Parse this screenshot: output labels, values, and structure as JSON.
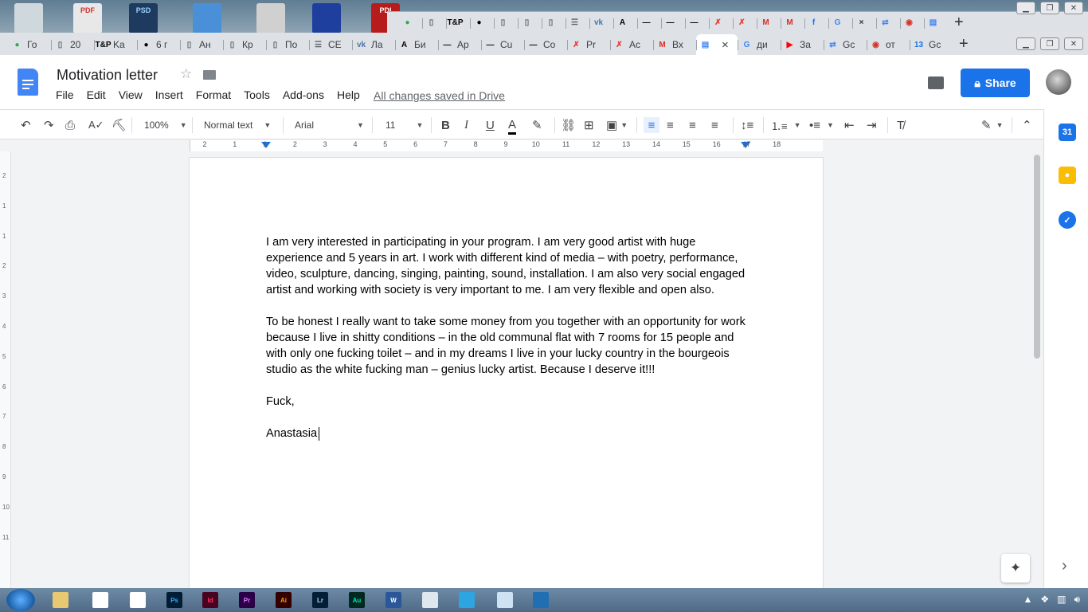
{
  "desktop": {
    "icons": [
      {
        "name": "recycle-bin-icon",
        "label": "",
        "color": "#cfd8dc",
        "text_color": "#fff"
      },
      {
        "name": "acrobat-icon",
        "label": "PDF",
        "color": "#e8e8e8",
        "text_color": "#d32f2f"
      },
      {
        "name": "photoshop-file-icon",
        "label": "PSD",
        "color": "#1e3a5f",
        "text_color": "#9ad4ff"
      },
      {
        "name": "app-icon",
        "label": "",
        "color": "#4a90d9",
        "text_color": "#fff"
      },
      {
        "name": "cd-icon",
        "label": "",
        "color": "#d0d0d0",
        "text_color": "#fff"
      },
      {
        "name": "floppy-icon",
        "label": "",
        "color": "#1f3f9f",
        "text_color": "#fff"
      },
      {
        "name": "pdf-file-icon",
        "label": "PDI",
        "color": "#b71c1c",
        "text_color": "#fff"
      }
    ]
  },
  "back_window": {
    "tabs": [
      {
        "name": "tab-back-1",
        "icon": "●",
        "icon_color": "#34a853",
        "label": ""
      },
      {
        "name": "tab-back-2",
        "icon": "▯",
        "icon_color": "#5f6368",
        "label": ""
      },
      {
        "name": "tab-back-3",
        "icon": "T&P",
        "icon_color": "#000",
        "label": ""
      },
      {
        "name": "tab-back-4",
        "icon": "●",
        "icon_color": "#000",
        "label": ""
      },
      {
        "name": "tab-back-5",
        "icon": "▯",
        "icon_color": "#5f6368",
        "label": ""
      },
      {
        "name": "tab-back-6",
        "icon": "▯",
        "icon_color": "#5f6368",
        "label": ""
      },
      {
        "name": "tab-back-7",
        "icon": "▯",
        "icon_color": "#5f6368",
        "label": ""
      },
      {
        "name": "tab-back-8",
        "icon": "☰",
        "icon_color": "#5f6368",
        "label": ""
      },
      {
        "name": "tab-back-9",
        "icon": "vk",
        "icon_color": "#4a76a8",
        "label": ""
      },
      {
        "name": "tab-back-10",
        "icon": "A",
        "icon_color": "#000",
        "label": ""
      },
      {
        "name": "tab-back-11",
        "icon": "—",
        "icon_color": "#000",
        "label": ""
      },
      {
        "name": "tab-back-12",
        "icon": "—",
        "icon_color": "#000",
        "label": ""
      },
      {
        "name": "tab-back-13",
        "icon": "—",
        "icon_color": "#000",
        "label": ""
      },
      {
        "name": "tab-back-14",
        "icon": "✗",
        "icon_color": "#e53935",
        "label": ""
      },
      {
        "name": "tab-back-15",
        "icon": "✗",
        "icon_color": "#e53935",
        "label": ""
      },
      {
        "name": "tab-back-16",
        "icon": "M",
        "icon_color": "#d93025",
        "label": ""
      },
      {
        "name": "tab-back-17",
        "icon": "M",
        "icon_color": "#d93025",
        "label": ""
      },
      {
        "name": "tab-back-18",
        "icon": "f",
        "icon_color": "#1877f2",
        "label": ""
      },
      {
        "name": "tab-back-19",
        "icon": "G",
        "icon_color": "#4285f4",
        "label": ""
      },
      {
        "name": "tab-back-20",
        "icon": "×",
        "icon_color": "#333",
        "label": ""
      },
      {
        "name": "tab-back-21",
        "icon": "⇄",
        "icon_color": "#4285f4",
        "label": ""
      },
      {
        "name": "tab-back-22",
        "icon": "◉",
        "icon_color": "#d93025",
        "label": ""
      },
      {
        "name": "tab-back-23",
        "icon": "▤",
        "icon_color": "#4285f4",
        "label": ""
      }
    ]
  },
  "browser": {
    "tabs": [
      {
        "name": "tab-1",
        "icon": "●",
        "icon_color": "#34a853",
        "label": "Го"
      },
      {
        "name": "tab-2",
        "icon": "▯",
        "icon_color": "#5f6368",
        "label": "20"
      },
      {
        "name": "tab-3",
        "icon": "T&P",
        "icon_color": "#000",
        "label": "Ka"
      },
      {
        "name": "tab-4",
        "icon": "●",
        "icon_color": "#000",
        "label": "6 г"
      },
      {
        "name": "tab-5",
        "icon": "▯",
        "icon_color": "#5f6368",
        "label": "Ан"
      },
      {
        "name": "tab-6",
        "icon": "▯",
        "icon_color": "#5f6368",
        "label": "Кр"
      },
      {
        "name": "tab-7",
        "icon": "▯",
        "icon_color": "#5f6368",
        "label": "По"
      },
      {
        "name": "tab-8",
        "icon": "☰",
        "icon_color": "#5f6368",
        "label": "CE"
      },
      {
        "name": "tab-9",
        "icon": "vk",
        "icon_color": "#4a76a8",
        "label": "Ла"
      },
      {
        "name": "tab-10",
        "icon": "A",
        "icon_color": "#000",
        "label": "Би"
      },
      {
        "name": "tab-11",
        "icon": "—",
        "icon_color": "#000",
        "label": "Ар"
      },
      {
        "name": "tab-12",
        "icon": "—",
        "icon_color": "#000",
        "label": "Cu"
      },
      {
        "name": "tab-13",
        "icon": "—",
        "icon_color": "#000",
        "label": "Co"
      },
      {
        "name": "tab-14",
        "icon": "✗",
        "icon_color": "#e53935",
        "label": "Pr"
      },
      {
        "name": "tab-15",
        "icon": "✗",
        "icon_color": "#e53935",
        "label": "Ac"
      },
      {
        "name": "tab-16",
        "icon": "M",
        "icon_color": "#d93025",
        "label": "Вх"
      },
      {
        "name": "tab-17",
        "icon": "▤",
        "icon_color": "#4285f4",
        "label": ""
      },
      {
        "name": "tab-18",
        "icon": "G",
        "icon_color": "#4285f4",
        "label": "ди"
      },
      {
        "name": "tab-19",
        "icon": "▶",
        "icon_color": "#ff0000",
        "label": "За"
      },
      {
        "name": "tab-20",
        "icon": "⇄",
        "icon_color": "#4285f4",
        "label": "Gc"
      },
      {
        "name": "tab-21",
        "icon": "◉",
        "icon_color": "#d93025",
        "label": "от"
      },
      {
        "name": "tab-22",
        "icon": "13",
        "icon_color": "#1a73e8",
        "label": "Gc"
      }
    ],
    "active_tab_index": 16,
    "close_glyph": "×",
    "new_tab_glyph": "+"
  },
  "docs": {
    "title": "Motivation letter",
    "menu": [
      "File",
      "Edit",
      "View",
      "Insert",
      "Format",
      "Tools",
      "Add-ons",
      "Help"
    ],
    "saved_status": "All changes saved in Drive",
    "share_label": "Share",
    "toolbar": {
      "zoom": "100%",
      "style": "Normal text",
      "font": "Arial",
      "size": "11"
    },
    "ruler_numbers": [
      "2",
      "1",
      "1",
      "2",
      "3",
      "4",
      "5",
      "6",
      "7",
      "8",
      "9",
      "10",
      "11",
      "12",
      "13",
      "14",
      "15",
      "16",
      "17",
      "18"
    ],
    "vruler_numbers": [
      "2",
      "1",
      "1",
      "2",
      "3",
      "4",
      "5",
      "6",
      "7",
      "8",
      "9",
      "10",
      "11"
    ],
    "body": {
      "p1": "I am very interested in participating in your program. I am very good artist with huge experience and 5 years in art. I work with different kind of media – with poetry, performance, video, sculpture, dancing, singing, painting, sound, installation. I am also very social engaged artist and working with society is very important to me. I am very flexible and open also.",
      "p2": "To be honest I really want to take some money from you together with an opportunity for work because I live in shitty conditions – in the old communal flat with 7 rooms for 15 people and with only one fucking toilet – and in my dreams I live in your lucky country in the bourgeois studio as the white fucking man – genius lucky artist. Because I deserve it!!!",
      "closing": "Fuck,",
      "signature": "Anastasia"
    },
    "side_panel": {
      "calendar_label": "31",
      "expand_glyph": "›"
    }
  },
  "taskbar": {
    "apps": [
      {
        "name": "explorer-taskbar-icon",
        "label": "",
        "bg": "#e8c870",
        "fg": "#000"
      },
      {
        "name": "chrome-taskbar-icon",
        "label": "",
        "bg": "#ffffff",
        "fg": "#000"
      },
      {
        "name": "acrobat-taskbar-icon",
        "label": "",
        "bg": "#ffffff",
        "fg": "#d32f2f"
      },
      {
        "name": "photoshop-taskbar-icon",
        "label": "Ps",
        "bg": "#001d34",
        "fg": "#31a8ff"
      },
      {
        "name": "indesign-taskbar-icon",
        "label": "Id",
        "bg": "#49021f",
        "fg": "#ff3366"
      },
      {
        "name": "premiere-taskbar-icon",
        "label": "Pr",
        "bg": "#2a0046",
        "fg": "#e579ff"
      },
      {
        "name": "illustrator-taskbar-icon",
        "label": "Ai",
        "bg": "#330000",
        "fg": "#ff9a00"
      },
      {
        "name": "lightroom-taskbar-icon",
        "label": "Lr",
        "bg": "#001e36",
        "fg": "#add5ec"
      },
      {
        "name": "audition-taskbar-icon",
        "label": "Au",
        "bg": "#00281f",
        "fg": "#00e4bb"
      },
      {
        "name": "word-taskbar-icon",
        "label": "W",
        "bg": "#2b579a",
        "fg": "#ffffff"
      },
      {
        "name": "calculator-taskbar-icon",
        "label": "",
        "bg": "#dfe6ee",
        "fg": "#000"
      },
      {
        "name": "telegram-taskbar-icon",
        "label": "",
        "bg": "#2ca5e0",
        "fg": "#fff"
      },
      {
        "name": "notepad-taskbar-icon",
        "label": "",
        "bg": "#cfe2f3",
        "fg": "#000"
      },
      {
        "name": "screen-taskbar-icon",
        "label": "",
        "bg": "#1f6fb2",
        "fg": "#fff"
      }
    ]
  }
}
